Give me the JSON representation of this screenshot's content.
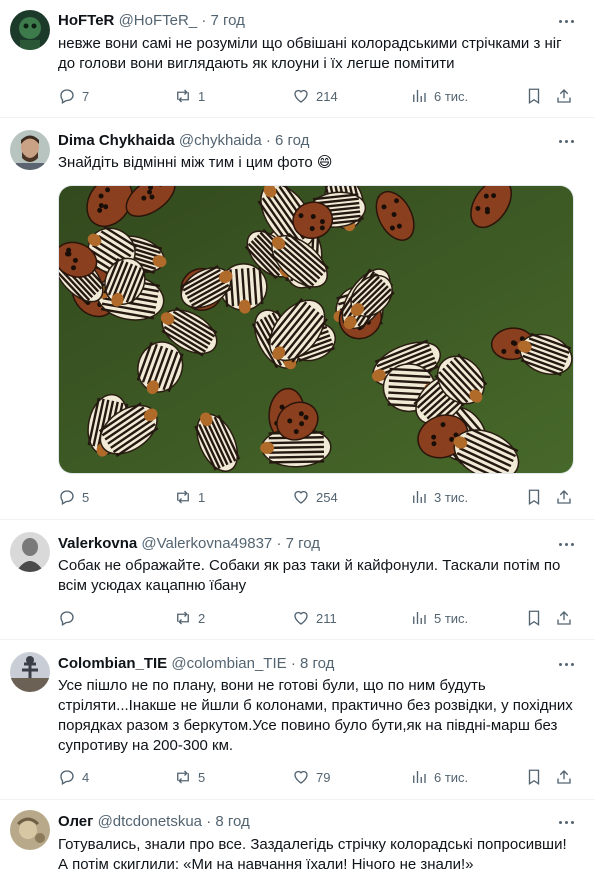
{
  "tweets": [
    {
      "name": "HoFTeR",
      "handle": "@HoFTeR_",
      "time": "· 7 год",
      "lines": [
        "невже вони самі не розуміли що обвішані колорадськими стрічками з ніг",
        "до голови вони виглядають як клоуни і їх легше помітити"
      ],
      "replies": "7",
      "reposts": "1",
      "likes": "214",
      "views": "6 тис."
    },
    {
      "name": "Dima Chykhaida",
      "handle": "@chykhaida",
      "time": "· 6 год",
      "lines": [
        "Знайдіть відмінні між тим і цим фото 😄"
      ],
      "replies": "5",
      "reposts": "1",
      "likes": "254",
      "views": "3 тис."
    },
    {
      "name": "Valerkovna",
      "handle": "@Valerkovna49837",
      "time": "· 7 год",
      "lines": [
        "Собак не ображайте. Собаки як раз таки й кайфонули. Таскали потім по",
        "всім усюдах кацапню їбану"
      ],
      "replies": "",
      "reposts": "2",
      "likes": "211",
      "views": "5 тис."
    },
    {
      "name": "Colombian_TIE",
      "handle": "@colombian_TIE",
      "time": "· 8 год",
      "lines": [
        "Усе пішло не по плану, вони не готові були, що по ним будуть",
        "стріляти...Інакше не йшли б колонами, практично без розвідки, у похідних",
        "порядках разом з беркутом.Усе повино було бути,як на півдні-марш без",
        "супротиву на 200-300 км."
      ],
      "replies": "4",
      "reposts": "5",
      "likes": "79",
      "views": "6 тис."
    },
    {
      "name": "Олег",
      "handle": "@dtcdonetskua",
      "time": "· 8 год",
      "lines": [
        "Готувались, знали про все. Заздалегідь стрічку колорадські попросивши!",
        "А потім скиглили: «Ми на навчання їхали! Нічого не знали!»"
      ]
    }
  ]
}
